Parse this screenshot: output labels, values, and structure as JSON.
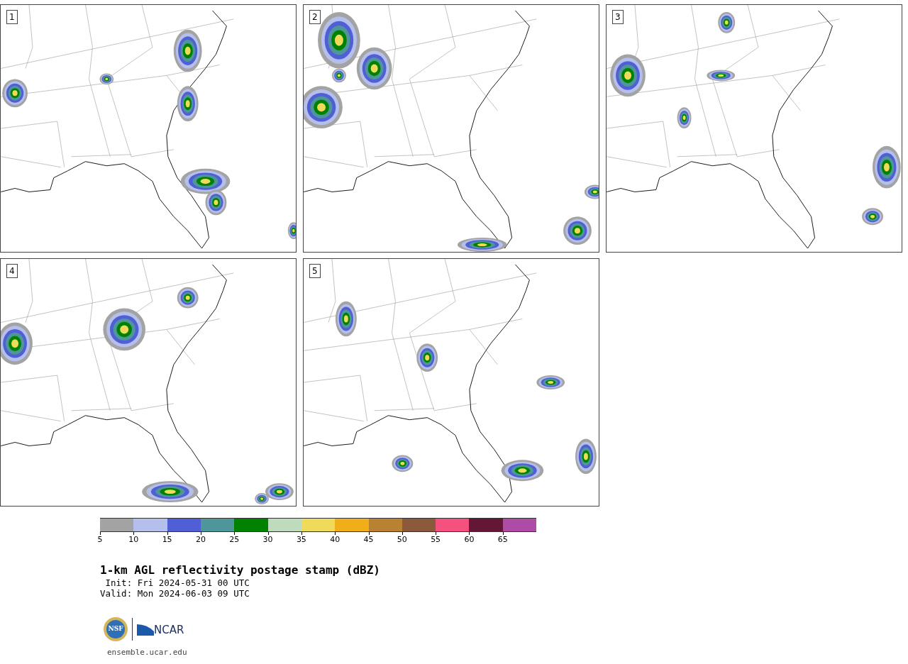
{
  "panels": [
    {
      "label": "1"
    },
    {
      "label": "2"
    },
    {
      "label": "3"
    },
    {
      "label": "4"
    },
    {
      "label": "5"
    }
  ],
  "colorbar": {
    "bins": [
      {
        "color": "#a3a3a3"
      },
      {
        "color": "#b5bfeb"
      },
      {
        "color": "#505fd5"
      },
      {
        "color": "#4f969b"
      },
      {
        "color": "#008200"
      },
      {
        "color": "#bedbbe"
      },
      {
        "color": "#f0da5a"
      },
      {
        "color": "#f0ae19"
      },
      {
        "color": "#b98232"
      },
      {
        "color": "#8b5a3c"
      },
      {
        "color": "#f4517f"
      },
      {
        "color": "#631636"
      },
      {
        "color": "#ad4ba6"
      }
    ],
    "ticks": [
      "5",
      "10",
      "15",
      "20",
      "25",
      "30",
      "35",
      "40",
      "45",
      "50",
      "55",
      "60",
      "65"
    ]
  },
  "title": "1-km AGL reflectivity postage stamp (dBZ)",
  "init": " Init: Fri 2024-05-31 00 UTC",
  "valid": "Valid: Mon 2024-06-03 09 UTC",
  "logo": {
    "nsf": "NSF",
    "ncar": "NCAR"
  },
  "footer": "ensemble.ucar.edu"
}
